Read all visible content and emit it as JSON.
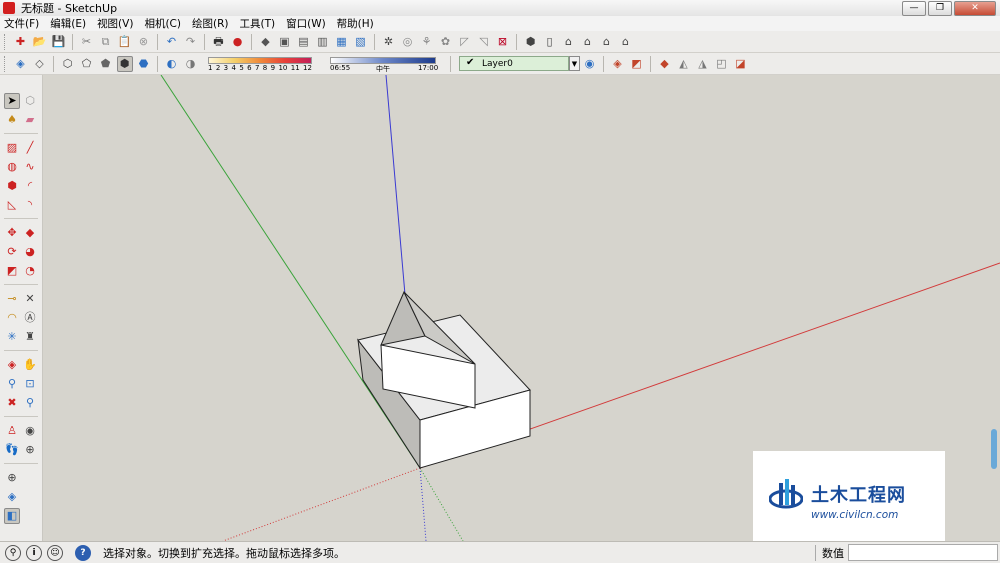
{
  "window": {
    "title": "无标题 - SketchUp"
  },
  "window_controls": {
    "minimize": "—",
    "maximize": "❐",
    "close": "✕"
  },
  "menu": [
    {
      "label": "文件(F)"
    },
    {
      "label": "编辑(E)"
    },
    {
      "label": "视图(V)"
    },
    {
      "label": "相机(C)"
    },
    {
      "label": "绘图(R)"
    },
    {
      "label": "工具(T)"
    },
    {
      "label": "窗口(W)"
    },
    {
      "label": "帮助(H)"
    }
  ],
  "shadow": {
    "month_ticks": [
      "1",
      "2",
      "3",
      "4",
      "5",
      "6",
      "7",
      "8",
      "9",
      "10",
      "11",
      "12"
    ]
  },
  "time": {
    "start": "06:55",
    "mid": "中午",
    "end": "17:00"
  },
  "layer": {
    "name": "Layer0",
    "active": true
  },
  "status": {
    "message": "选择对象。切换到扩充选择。拖动鼠标选择多项。",
    "value_label": "数值",
    "value": ""
  },
  "watermark": {
    "name": "土木工程网",
    "url": "www.civilcn.com"
  },
  "colors": {
    "viewport_bg": "#d6d4cd",
    "axis_red": "#d23a3a",
    "axis_green": "#3aa33a",
    "axis_blue": "#3a3ad2",
    "brand_blue": "#1a4d9c"
  },
  "icons": {
    "toolbar1": [
      "new-file-icon",
      "open-icon",
      "save-icon",
      "cut-icon",
      "copy-icon",
      "paste-icon",
      "erase-icon",
      "undo-icon",
      "redo-icon",
      "print-icon",
      "model-info-icon",
      "iso-view-icon",
      "top-view-icon",
      "front-view-icon",
      "right-view-icon",
      "back-view-icon",
      "left-view-icon",
      "get-models-icon",
      "share-model-icon",
      "get-photo-icon",
      "texture-icon",
      "flip-icon",
      "gallery-icon",
      "component-icon",
      "warehouse-icon",
      "home-icon",
      "house-icon",
      "building-icon",
      "house2-icon"
    ],
    "toolbar2": [
      "xray-icon",
      "wireframe-icon",
      "hidden-line-icon",
      "shaded-icon",
      "textured-icon",
      "monochrome-icon",
      "shadow-toggle-icon",
      "fog-icon",
      "layer-manager-icon",
      "section-plane-icon",
      "section-cut-icon",
      "sandbox-icon",
      "stamp-icon",
      "drape-icon",
      "add-detail-icon",
      "flip-edge-icon"
    ],
    "lefttools": [
      "select-icon",
      "component-icon",
      "paint-bucket-icon",
      "eraser-icon",
      "rectangle-icon",
      "line-icon",
      "circle-icon",
      "freehand-icon",
      "polygon-icon",
      "arc-icon",
      "push-pull-icon",
      "follow-me-icon",
      "move-icon",
      "rotate-icon",
      "offset-icon",
      "scale-icon",
      "tape-measure-icon",
      "dimension-icon",
      "protractor-icon",
      "text-icon",
      "axes-icon",
      "3d-text-icon",
      "orbit-icon",
      "pan-icon",
      "zoom-icon",
      "zoom-window-icon",
      "zoom-extents-icon",
      "previous-view-icon",
      "position-camera-icon",
      "look-around-icon",
      "walk-icon",
      "section-icon",
      "diamond-icon",
      "sandbox-tool-icon",
      "select-mode-icon"
    ]
  }
}
